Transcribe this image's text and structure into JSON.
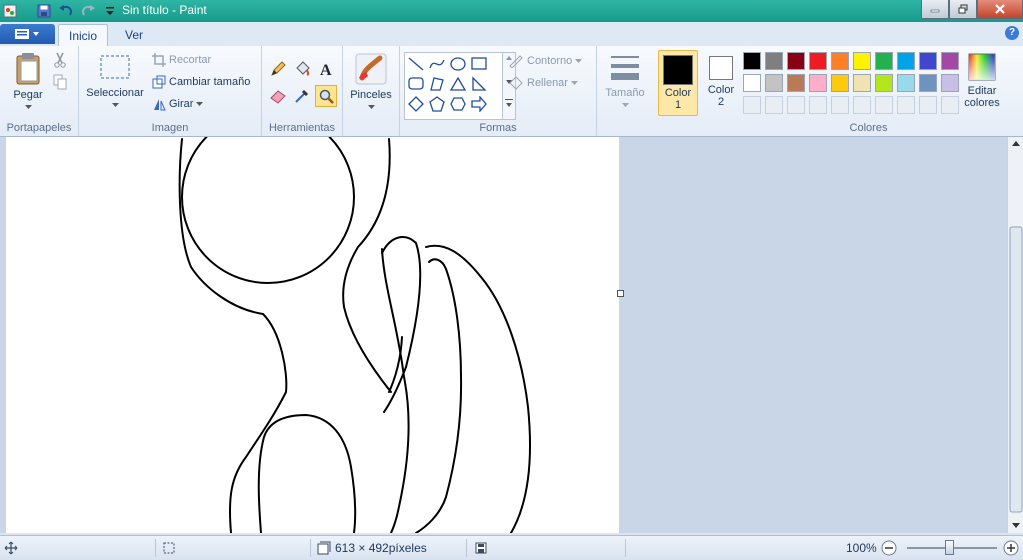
{
  "window": {
    "title": "Sin título - Paint"
  },
  "tabs": {
    "file_menu": "",
    "home": "Inicio",
    "view": "Ver"
  },
  "ribbon": {
    "clipboard": {
      "paste": "Pegar",
      "group": "Portapapeles"
    },
    "image": {
      "select": "Seleccionar",
      "crop": "Recortar",
      "resize": "Cambiar tamaño",
      "rotate": "Girar",
      "group": "Imagen"
    },
    "tools": {
      "group": "Herramientas"
    },
    "brushes": {
      "label": "Pinceles"
    },
    "shapes": {
      "outline": "Contorno",
      "fill": "Rellenar",
      "group": "Formas"
    },
    "size": {
      "label": "Tamaño"
    },
    "colors": {
      "color1": "Color\n1",
      "color1_a": "Color",
      "color1_b": "1",
      "color2_a": "Color",
      "color2_b": "2",
      "edit_a": "Editar",
      "edit_b": "colores",
      "group": "Colores",
      "color1_value": "#000000",
      "color2_value": "#ffffff",
      "palette_row1": [
        "#000000",
        "#7f7f7f",
        "#880015",
        "#ed1c24",
        "#ff7f27",
        "#fff200",
        "#22b14c",
        "#00a2e8",
        "#3f48cc",
        "#a349a4"
      ],
      "palette_row2": [
        "#ffffff",
        "#c3c3c3",
        "#b97a57",
        "#ffaec9",
        "#ffc90e",
        "#efe4b0",
        "#b5e61d",
        "#99d9ea",
        "#7092be",
        "#c8bfe7"
      ]
    }
  },
  "statusbar": {
    "dimensions": "613 × 492píxeles",
    "zoom": "100%"
  }
}
